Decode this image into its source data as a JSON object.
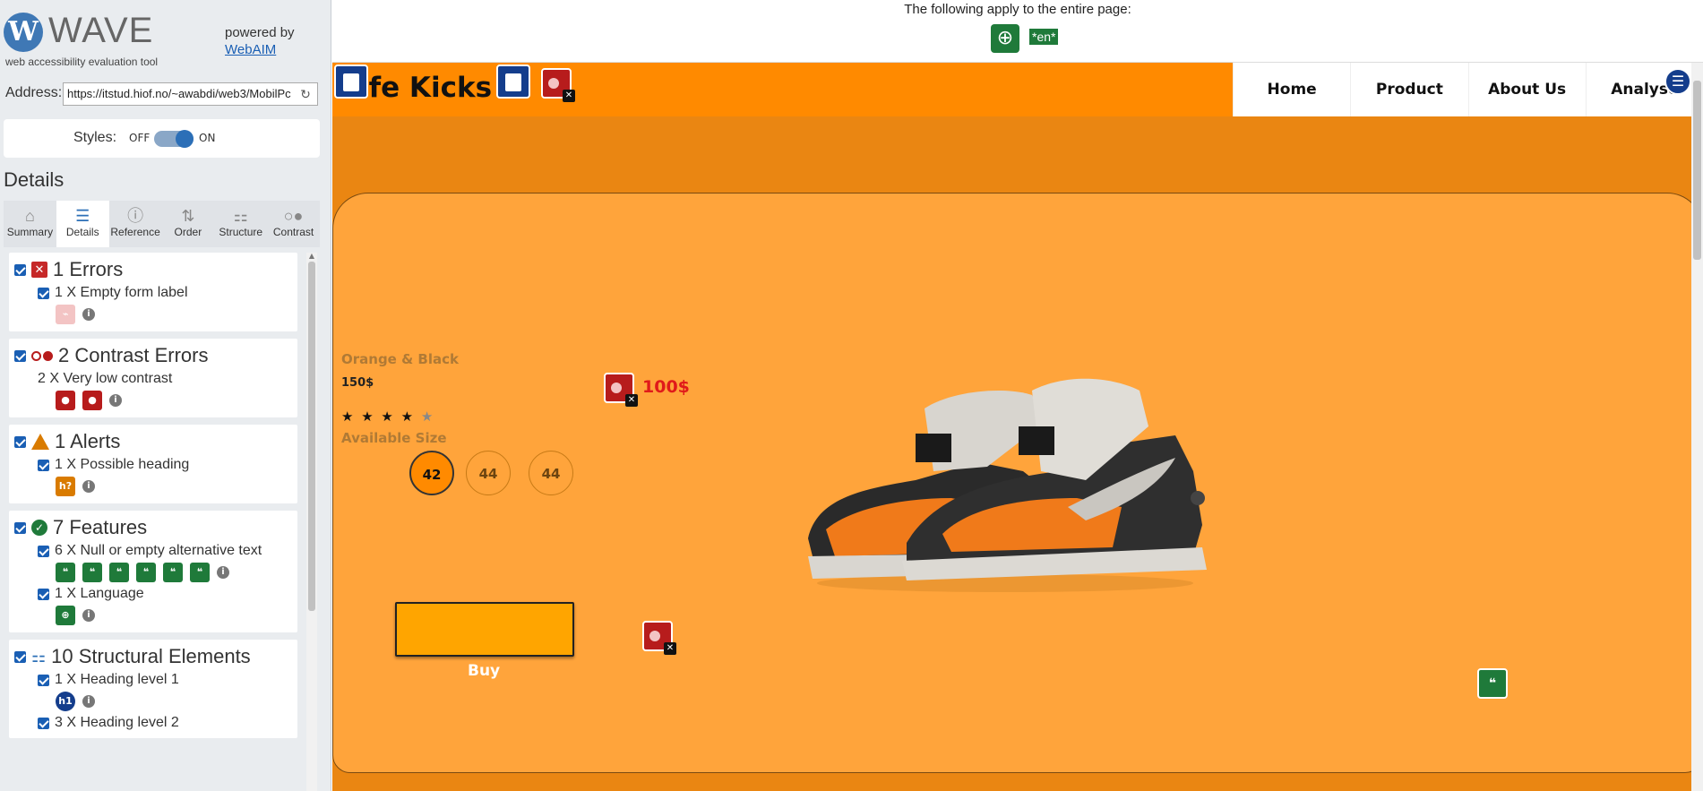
{
  "wave": {
    "logo_letter": "W",
    "logo_word": "WAVE",
    "subtitle": "web accessibility evaluation tool",
    "powered_by": "powered by",
    "webaim_link": "WebAIM",
    "address_label": "Address:",
    "address_value": "https://itstud.hiof.no/~awabdi/web3/MobilPc",
    "styles_label": "Styles:",
    "styles_off": "OFF",
    "styles_on": "ON",
    "details_heading": "Details",
    "tabs": [
      {
        "label": "Summary",
        "icon": "home-icon"
      },
      {
        "label": "Details",
        "icon": "list-icon"
      },
      {
        "label": "Reference",
        "icon": "info-icon"
      },
      {
        "label": "Order",
        "icon": "order-icon"
      },
      {
        "label": "Structure",
        "icon": "structure-icon"
      },
      {
        "label": "Contrast",
        "icon": "contrast-icon"
      }
    ],
    "categories": {
      "errors": {
        "title": "1 Errors",
        "items": [
          {
            "label": "1 X Empty form label"
          }
        ]
      },
      "contrast": {
        "title": "2 Contrast Errors",
        "items": [
          {
            "label": "2 X Very low contrast"
          }
        ]
      },
      "alerts": {
        "title": "1 Alerts",
        "items": [
          {
            "label": "1 X Possible heading"
          }
        ]
      },
      "features": {
        "title": "7 Features",
        "items": [
          {
            "label": "6 X Null or empty alternative text"
          },
          {
            "label": "1 X Language"
          }
        ]
      },
      "structure": {
        "title": "10 Structural Elements",
        "items": [
          {
            "label": "1 X Heading level 1"
          },
          {
            "label": "3 X Heading level 2"
          }
        ]
      }
    }
  },
  "page_info": {
    "notice": "The following apply to the entire page:",
    "lang_tag": "*en*"
  },
  "site": {
    "brand": "ife Kicks",
    "nav": [
      "Home",
      "Product",
      "About Us",
      "Analyse"
    ],
    "product_name": "Orange & Black",
    "product_price": "150$",
    "stars_filled": "★ ★ ★ ★",
    "stars_empty": "★",
    "available_size": "Available Size",
    "sizes": [
      "42",
      "44",
      "44"
    ],
    "sale_price": "100$",
    "buy_label": "Buy"
  },
  "colors": {
    "wave_blue": "#2c6fb7",
    "site_orange": "#ff8a00",
    "hero_orange": "#ffa43b",
    "error_red": "#b71c1c",
    "feature_green": "#1f7a3a"
  }
}
